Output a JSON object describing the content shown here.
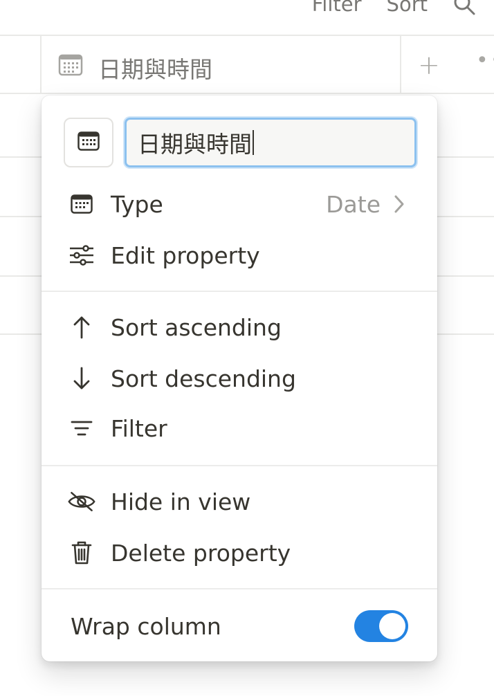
{
  "toolbar": {
    "filter_label": "Filter",
    "sort_label": "Sort"
  },
  "table": {
    "column_title": "日期與時間",
    "add_column": "+",
    "more": "••"
  },
  "menu": {
    "name_value": "日期與時間",
    "type": {
      "label": "Type",
      "value": "Date"
    },
    "edit_property": "Edit property",
    "sort_ascending": "Sort ascending",
    "sort_descending": "Sort descending",
    "filter": "Filter",
    "hide_in_view": "Hide in view",
    "delete_property": "Delete property",
    "wrap_column": "Wrap column",
    "wrap_column_enabled": true
  },
  "colors": {
    "accent": "#2383e2",
    "text": "#37352f",
    "muted": "#9b9a97",
    "border": "#e9e9e7"
  }
}
